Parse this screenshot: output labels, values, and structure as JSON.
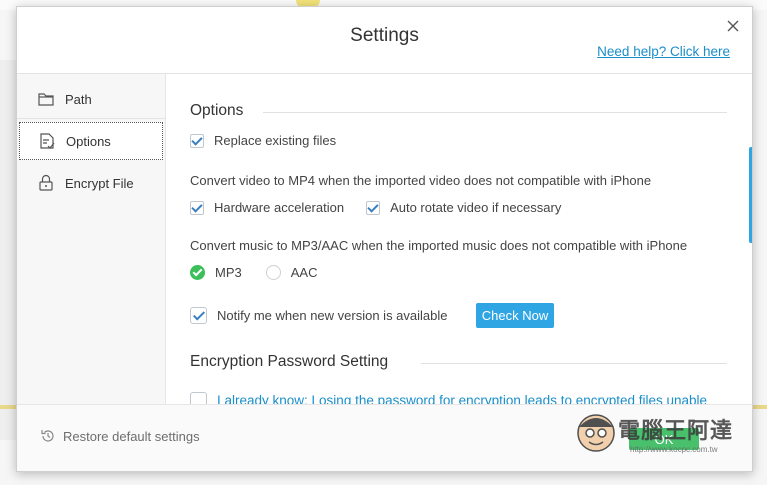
{
  "dialog": {
    "title": "Settings",
    "help_link": "Need help? Click here"
  },
  "sidebar": {
    "items": [
      {
        "label": "Path",
        "icon": "folder-icon"
      },
      {
        "label": "Options",
        "icon": "document-options-icon",
        "active": true
      },
      {
        "label": "Encrypt File",
        "icon": "lock-icon"
      }
    ]
  },
  "options": {
    "section_title": "Options",
    "replace_existing": {
      "label": "Replace existing files",
      "checked": true
    },
    "video_note": "Convert video to MP4 when the imported video does not compatible with iPhone",
    "hardware_acceleration": {
      "label": "Hardware acceleration",
      "checked": true
    },
    "auto_rotate": {
      "label": "Auto rotate video if necessary",
      "checked": true
    },
    "music_note": "Convert music to MP3/AAC when the imported music does not compatible with iPhone",
    "music_format": {
      "options": [
        "MP3",
        "AAC"
      ],
      "selected": "MP3"
    },
    "notify": {
      "label": "Notify me when new version is available",
      "checked": true
    },
    "check_now": "Check Now"
  },
  "encryption": {
    "section_title": "Encryption Password Setting",
    "acknowledge": {
      "label": "I already know: Losing the password for encryption leads to encrypted files unable",
      "checked": false
    }
  },
  "footer": {
    "restore_label": "Restore default settings",
    "ok_label": "OK"
  },
  "watermark": {
    "text": "電腦王阿達",
    "url": "http://www.kocpc.com.tw"
  },
  "colors": {
    "accent": "#2fa6e3",
    "link": "#1a8ec9",
    "ok_green": "#48c06c",
    "radio_green": "#3cbf5a"
  }
}
